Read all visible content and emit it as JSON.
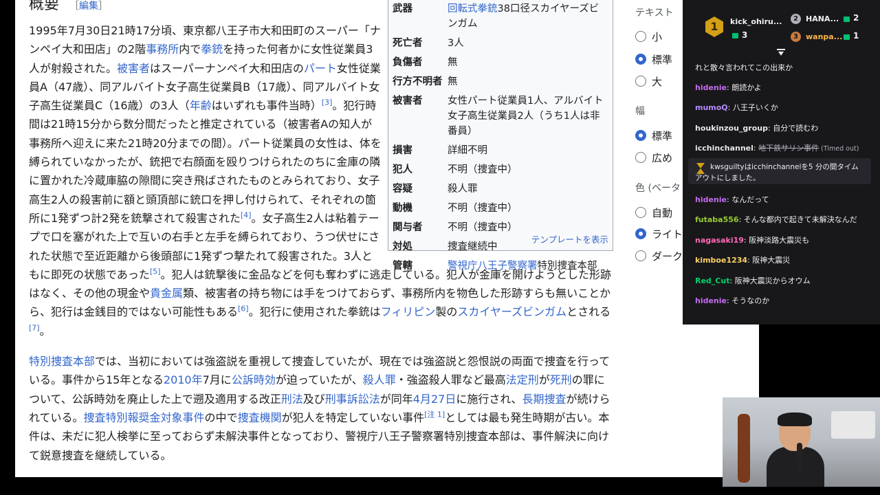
{
  "article": {
    "heading": "概要",
    "edit_label": "編集",
    "paragraphs": [
      [
        {
          "t": "1995年7月30日21時17分頃、東京都八王子市大和田町のスーパー「ナンペイ大和田店」の2階"
        },
        {
          "t": "事務所",
          "link": true
        },
        {
          "t": "内で"
        },
        {
          "t": "拳銃",
          "link": true
        },
        {
          "t": "を持った何者かに女性従業員3人が射殺された。"
        },
        {
          "t": "被害者",
          "link": true
        },
        {
          "t": "はスーパーナンペイ大和田店の"
        },
        {
          "t": "パート",
          "link": true
        },
        {
          "t": "女性従業員A（47歳）、同アルバイト女子高生従業員B（17歳）、同アルバイト女子高生従業員C（16歳）の3人（"
        },
        {
          "t": "年齢",
          "link": true
        },
        {
          "t": "はいずれも事件当時）"
        },
        {
          "t": "[3]",
          "sup": true
        },
        {
          "t": "。犯行時間は21時15分から数分間だったと推定されている（被害者Aの知人が事務所へ迎えに来た21時20分までの間）。パート従業員の女性は、体を縛られていなかったが、銃把で右顔面を殴りつけられたのちに金庫の隣に置かれた冷蔵庫脇の隙間に突き飛ばされたものとみられており、女子高生2人の殺害前に額と頭頂部に銃口を押し付けられて、それぞれの箇所に1発ずつ計2発を銃撃されて殺害された"
        },
        {
          "t": "[4]",
          "sup": true
        },
        {
          "t": "。女子高生2人は粘着テープで口を塞がれた上で互いの右手と左手を縛られており、うつ伏せにされた状態で至近距離から後頭部に1発ずつ撃たれて殺害された。3人ともに即死の状態であった"
        },
        {
          "t": "[5]",
          "sup": true
        },
        {
          "t": "。犯人は銃撃後に金品などを何も奪わずに逃走している。犯人が金庫を開けようとした形跡はなく、その他の現金や"
        },
        {
          "t": "貴金属",
          "link": true
        },
        {
          "t": "類、被害者の持ち物には手をつけておらず、事務所内を物色した形跡すらも無いことから、犯行は金銭目的ではない可能性もある"
        },
        {
          "t": "[6]",
          "sup": true
        },
        {
          "t": "。犯行に使用された拳銃は"
        },
        {
          "t": "フィリピン",
          "link": true
        },
        {
          "t": "製の"
        },
        {
          "t": "スカイヤーズビンガム",
          "link": true
        },
        {
          "t": "とされる"
        },
        {
          "t": "[7]",
          "sup": true
        },
        {
          "t": "。"
        }
      ],
      [
        {
          "t": "特別捜査本部",
          "link": true
        },
        {
          "t": "では、当初においては強盗説を重視して捜査していたが、現在では強盗説と怨恨説の両面で捜査を行っている。事件から15年となる"
        },
        {
          "t": "2010年",
          "link": true
        },
        {
          "t": "7月に"
        },
        {
          "t": "公訴時効",
          "link": true
        },
        {
          "t": "が迫っていたが、"
        },
        {
          "t": "殺人罪",
          "link": true
        },
        {
          "t": "・強盗殺人罪など最高"
        },
        {
          "t": "法定刑",
          "link": true
        },
        {
          "t": "が"
        },
        {
          "t": "死刑",
          "link": true
        },
        {
          "t": "の罪について、公訴時効を廃止した上で遡及適用する改正"
        },
        {
          "t": "刑法",
          "link": true
        },
        {
          "t": "及び"
        },
        {
          "t": "刑事訴訟法",
          "link": true
        },
        {
          "t": "が同年"
        },
        {
          "t": "4月27日",
          "link": true
        },
        {
          "t": "に施行され、"
        },
        {
          "t": "長期捜査",
          "link": true
        },
        {
          "t": "が続けられている。"
        },
        {
          "t": "捜査特別報奨金対象事件",
          "link": true
        },
        {
          "t": "の中で"
        },
        {
          "t": "捜査機関",
          "link": true
        },
        {
          "t": "が犯人を特定していない事件"
        },
        {
          "t": "[注 1]",
          "sup": true
        },
        {
          "t": "としては最も発生時期が古い。本件は、未だに犯人検挙に至っておらず未解決事件となっており、警視庁八王子警察署特別捜査本部は、事件解決に向けて鋭意捜査を継続している。"
        }
      ]
    ]
  },
  "infobox": {
    "rows": [
      {
        "key": "武器",
        "value": [
          {
            "t": "回転式拳銃",
            "link": true
          },
          {
            "t": "38口径スカイヤーズビンガム"
          }
        ]
      },
      {
        "key": "死亡者",
        "value": [
          {
            "t": "3人"
          }
        ]
      },
      {
        "key": "負傷者",
        "value": [
          {
            "t": "無"
          }
        ]
      },
      {
        "key": "行方不明者",
        "value": [
          {
            "t": "無"
          }
        ]
      },
      {
        "key": "被害者",
        "value": [
          {
            "t": "女性パート従業員1人、アルバイト女子高生従業員2人（うち1人は非番員）"
          }
        ]
      },
      {
        "key": "損害",
        "value": [
          {
            "t": "詳細不明"
          }
        ]
      },
      {
        "key": "犯人",
        "value": [
          {
            "t": "不明（捜査中）"
          }
        ]
      },
      {
        "key": "容疑",
        "value": [
          {
            "t": "殺人罪"
          }
        ]
      },
      {
        "key": "動機",
        "value": [
          {
            "t": "不明（捜査中）"
          }
        ]
      },
      {
        "key": "関与者",
        "value": [
          {
            "t": "不明（捜査中）"
          }
        ]
      },
      {
        "key": "対処",
        "value": [
          {
            "t": "捜査継続中"
          }
        ]
      },
      {
        "key": "管轄",
        "value": [
          {
            "t": "警視庁八王子警察署",
            "link": true
          },
          {
            "t": "特別捜査本部"
          }
        ]
      }
    ],
    "template_link": "テンプレートを表示"
  },
  "settings": {
    "text_label": "テキスト",
    "text_options": [
      "小",
      "標準",
      "大"
    ],
    "text_selected": "標準",
    "width_label": "幅",
    "width_options": [
      "標準",
      "広め"
    ],
    "width_selected": "標準",
    "color_label": "色 (ベータ",
    "color_options": [
      "自動",
      "ライト",
      "ダーク"
    ],
    "color_selected": "ライト"
  },
  "chat": {
    "leaderboard": [
      {
        "rank": "1",
        "name": "kick_ohiru...",
        "count": "3",
        "medal_color": "#d4a017"
      },
      {
        "rank": "2",
        "name": "HANA...",
        "count": "2",
        "medal_color": "#b0b0b8"
      },
      {
        "rank": "3",
        "name": "wanpa...",
        "count": "1",
        "medal_color": "#c87a3c"
      }
    ],
    "messages": [
      {
        "user": "",
        "color": "#efeff1",
        "text": "れと散々言われてこの出来か"
      },
      {
        "user": "hidenie",
        "color": "#c56cf0",
        "text": "朗読かよ"
      },
      {
        "user": "mumoQ",
        "color": "#b58cff",
        "text": "八王子いくか"
      },
      {
        "user": "houkinzou_group",
        "color": "#e8e8e8",
        "text": "自分で読むわ"
      },
      {
        "user": "icchinchannel",
        "color": "#e8e8e8",
        "text": "地下鉄サリン事件",
        "deleted": true,
        "note": "(Timed out)"
      },
      {
        "user": "hidenie",
        "color": "#c56cf0",
        "text": "なんだって"
      },
      {
        "user": "futaba556",
        "color": "#9acd32",
        "text": "そんな都内で起きて未解決なんだ"
      },
      {
        "user": "nagasaki19",
        "color": "#ff69b4",
        "text": "阪神淡路大震災も"
      },
      {
        "user": "kimboe1234",
        "color": "#ffd166",
        "text": "阪神大震災"
      },
      {
        "user": "Red_Cut",
        "color": "#00d26a",
        "text": "阪神大震災からオウム"
      },
      {
        "user": "hidenie",
        "color": "#c56cf0",
        "text": "そうなのか"
      }
    ],
    "timeout_notice_line1": "kwsguiltyはicchinchannelを5 分の間タイム",
    "timeout_notice_line2": "アウトにしました。",
    "colors": {
      "bg": "#18181b",
      "gem": "#00c070",
      "timeout_icon": "#d4a017"
    }
  },
  "webcam": {
    "label": ""
  }
}
